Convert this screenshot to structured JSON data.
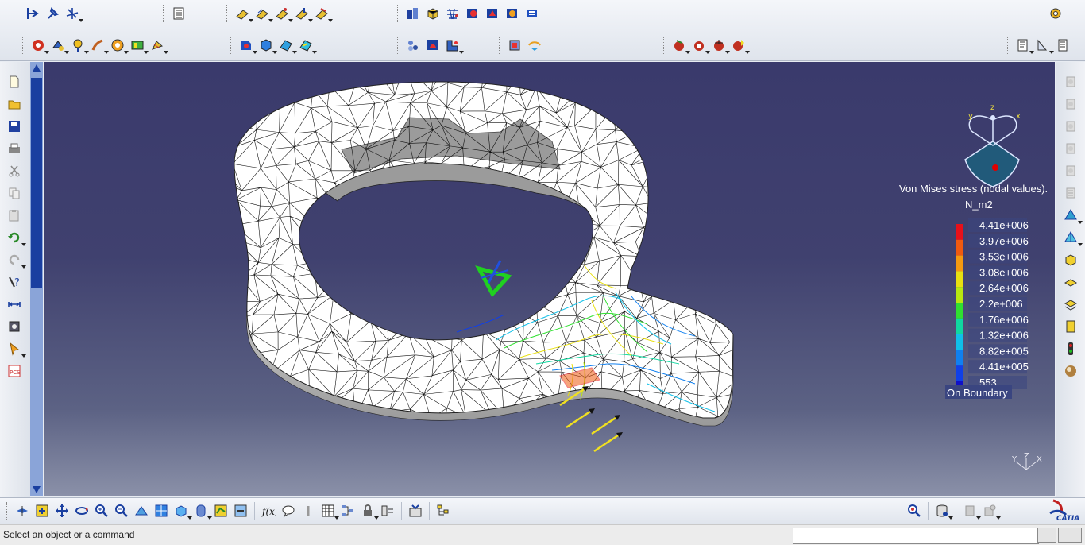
{
  "status_bar": {
    "message": "Select an object or a command",
    "command_value": ""
  },
  "brand": {
    "logo_text": "CATIA"
  },
  "compass": {
    "axis_x": "x",
    "axis_y": "y",
    "axis_z": "z"
  },
  "triad": {
    "x": "X",
    "y": "Y",
    "z": "Z"
  },
  "legend": {
    "title": "Von Mises stress (nodal values).",
    "unit": "N_m2",
    "values": [
      "4.41e+006",
      "3.97e+006",
      "3.53e+006",
      "3.08e+006",
      "2.64e+006",
      "2.2e+006",
      "1.76e+006",
      "1.32e+006",
      "8.82e+005",
      "4.41e+005",
      "553"
    ],
    "colors": [
      "#e8101a",
      "#f05a10",
      "#f59a10",
      "#e8e010",
      "#b8e810",
      "#30e030",
      "#10d8a0",
      "#10c0e8",
      "#1080f0",
      "#1040e8",
      "#1010c8"
    ],
    "boundary_label": "On Boundary"
  },
  "load_arrows": {
    "count": 4,
    "color": "#f0e020"
  },
  "mesh_colors": {
    "surface": "#ffffff",
    "edges": "#111111",
    "shadow": "#b5b5b5"
  }
}
